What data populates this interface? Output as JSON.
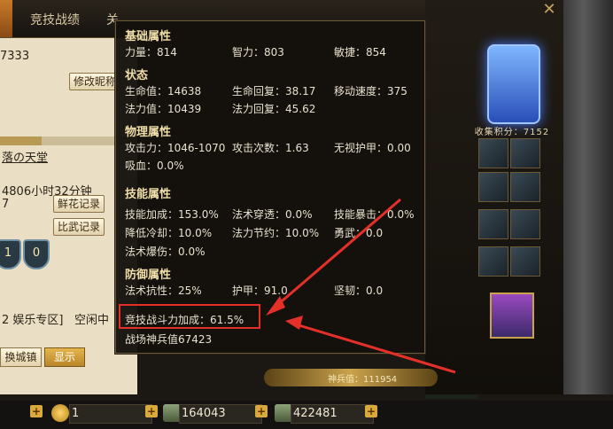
{
  "tabs": [
    "竞技战绩",
    "关"
  ],
  "profile": {
    "id_fragment": "7333",
    "rename_button": "修改昵称",
    "guild": "落の天堂",
    "online_time": "4806小时32分钟",
    "count_fragment": "7",
    "flowers_button": "鲜花记录",
    "duel_button": "比武记录",
    "level_progress": 0.3,
    "shield_values": [
      "1",
      "0"
    ],
    "server_line": "2  娱乐专区]",
    "status": "空闲中",
    "city_button": "换城镇",
    "show_button": "显示"
  },
  "tooltip": {
    "sections": [
      {
        "title": "基础属性",
        "rows": [
          [
            "力量：814",
            "智力：803",
            "敏捷：854"
          ]
        ]
      },
      {
        "title": "状态",
        "rows": [
          [
            "生命值：14638",
            "生命回复：38.17",
            "移动速度：375"
          ],
          [
            "法力值：10439",
            "法力回复：45.62",
            ""
          ]
        ]
      },
      {
        "title": "物理属性",
        "rows": [
          [
            "攻击力：1046-1070",
            "攻击次数：1.63",
            "无视护甲：0.00"
          ],
          [
            "吸血：0.0%",
            "",
            ""
          ]
        ]
      },
      {
        "title": "技能属性",
        "rows": [
          [
            "技能加成：153.0%",
            "法术穿透：0.0%",
            "技能暴击：0.0%"
          ],
          [
            "降低冷却：10.0%",
            "法力节约：10.0%",
            "勇武：0.0"
          ],
          [
            "法术爆伤：0.0%",
            "",
            ""
          ]
        ]
      },
      {
        "title": "防御属性",
        "rows": [
          [
            "法术抗性：25%",
            "护甲：91.0",
            "坚韧：0.0"
          ]
        ]
      }
    ],
    "arena_bonus": "竞技战斗力加成：61.5%",
    "divine_weapon": "战场神兵值67423"
  },
  "right_panel": {
    "collect_score": "收集积分：7152",
    "weapon_value": "神兵值：111954"
  },
  "bottom_bar": {
    "gold": "1",
    "currency_a": "164043",
    "currency_b": "422481",
    "plus": "+"
  },
  "colors": {
    "highlight": "#e5302a",
    "accent": "#d9a93b"
  }
}
